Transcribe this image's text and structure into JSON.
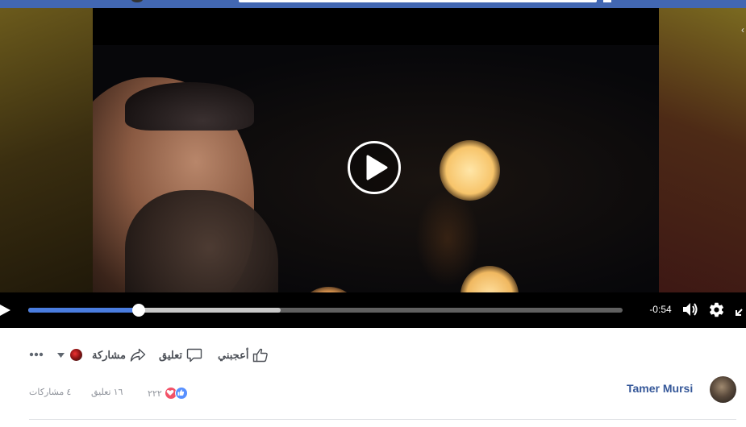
{
  "video": {
    "time_remaining": "-0:54",
    "progress_fraction": 0.186,
    "buffered_fraction": 0.425
  },
  "actions": {
    "like_label": "أعجبني",
    "comment_label": "تعليق",
    "share_label": "مشاركة"
  },
  "stats": {
    "reactions_count": "٢٢٢",
    "comments": "١٦ تعليق",
    "shares": "٤ مشاركات"
  },
  "author": {
    "name": "Tamer Mursi"
  },
  "icons": {
    "play": "play-icon",
    "volume": "volume-icon",
    "settings": "gear-icon",
    "fullscreen": "fullscreen-icon",
    "like": "thumbs-up-icon",
    "comment": "comment-icon",
    "share": "share-arrow-icon",
    "more": "more-dots-icon",
    "caret": "caret-down-icon"
  },
  "colors": {
    "brand_bar": "#4267b2",
    "progress": "#4a7de0",
    "author_link": "#365899",
    "action_text": "#4b4f56",
    "stats_text": "#90949c",
    "heart": "#f25268",
    "like": "#5890ff"
  }
}
